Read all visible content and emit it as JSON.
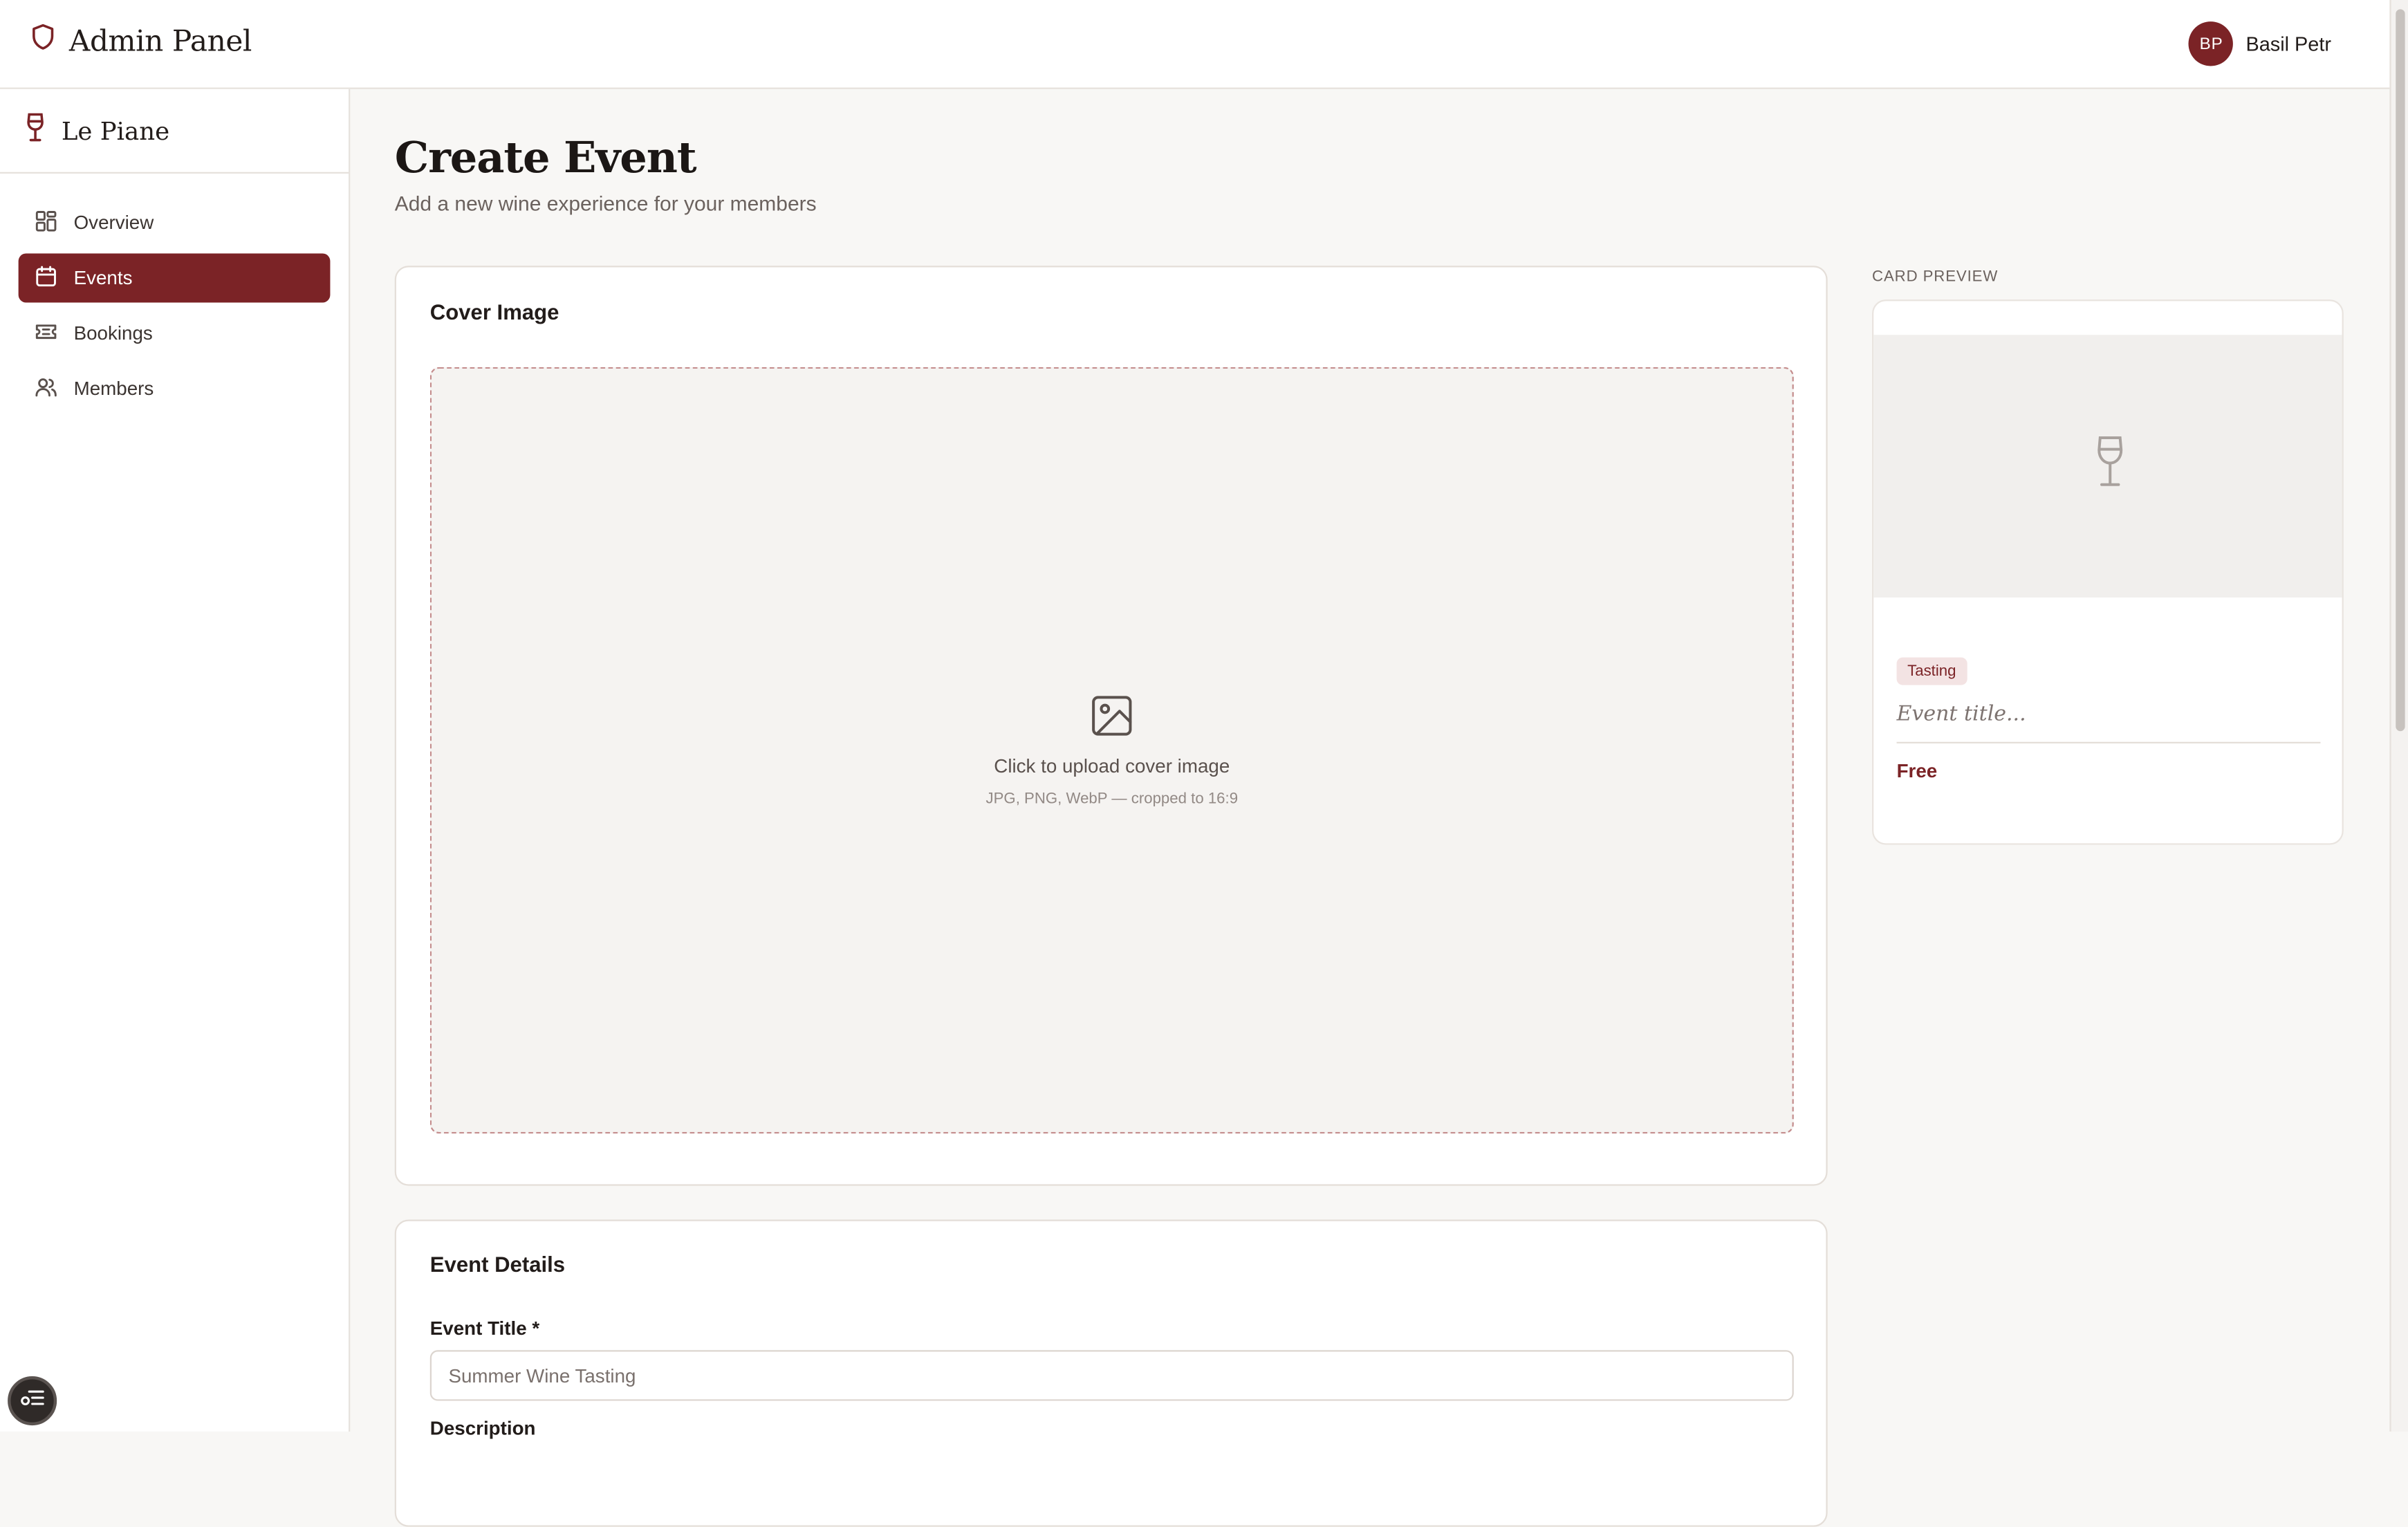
{
  "header": {
    "app_title": "Admin Panel",
    "user": {
      "initials": "BP",
      "name": "Basil Petr"
    }
  },
  "sidebar": {
    "venue_name": "Le Piane",
    "items": [
      {
        "label": "Overview",
        "icon": "grid-icon",
        "active": false
      },
      {
        "label": "Events",
        "icon": "calendar-icon",
        "active": true
      },
      {
        "label": "Bookings",
        "icon": "ticket-icon",
        "active": false
      },
      {
        "label": "Members",
        "icon": "users-icon",
        "active": false
      }
    ]
  },
  "main": {
    "title": "Create Event",
    "subtitle": "Add a new wine experience for your members",
    "cover_image": {
      "heading": "Cover Image",
      "upload_text": "Click to upload cover image",
      "upload_hint": "JPG, PNG, WebP — cropped to 16:9"
    },
    "event_details": {
      "heading": "Event Details",
      "title_label": "Event Title *",
      "title_placeholder": "Summer Wine Tasting",
      "description_label": "Description"
    }
  },
  "preview": {
    "label": "CARD PREVIEW",
    "tag": "Tasting",
    "title_placeholder": "Event title...",
    "price": "Free"
  },
  "colors": {
    "accent": "#7b2326",
    "background": "#f8f7f5",
    "dropzone_border": "#c48c8c"
  }
}
